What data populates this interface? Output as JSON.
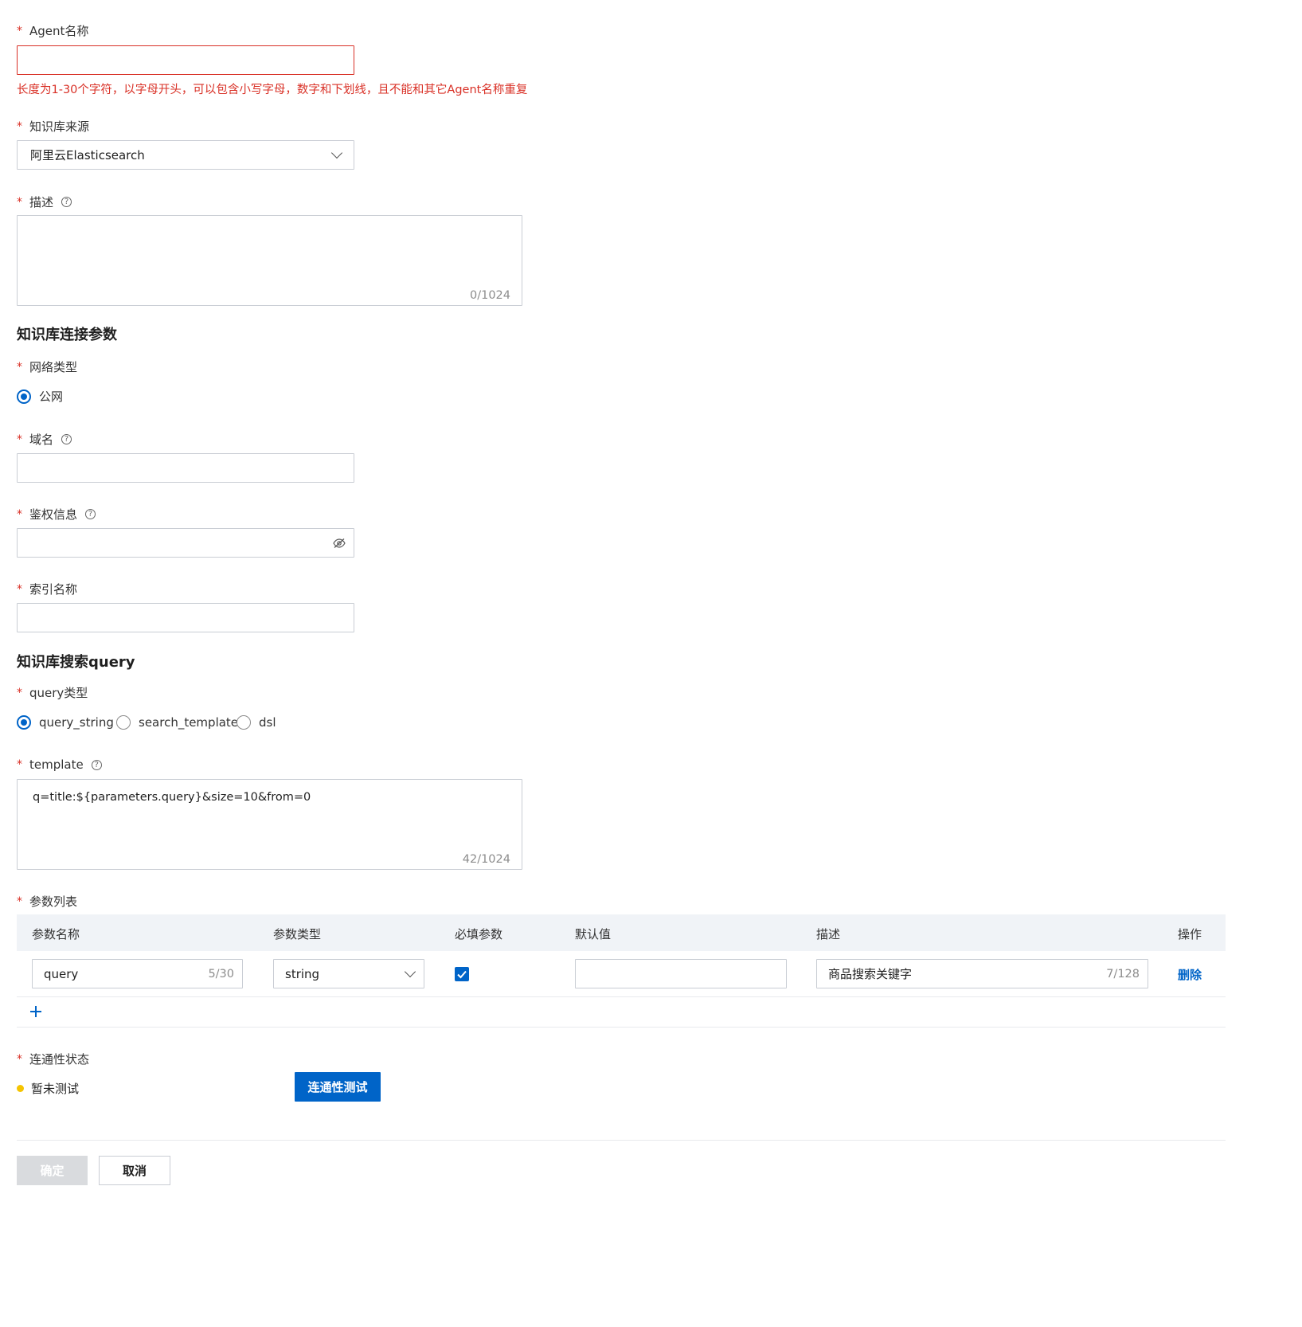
{
  "agent_name": {
    "label": "Agent名称",
    "value": "",
    "error": "长度为1-30个字符，以字母开头，可以包含小写字母，数字和下划线，且不能和其它Agent名称重复"
  },
  "kb_source": {
    "label": "知识库来源",
    "value": "阿里云Elasticsearch"
  },
  "description": {
    "label": "描述",
    "value": "",
    "counter": "0/1024"
  },
  "section_conn": {
    "title": "知识库连接参数"
  },
  "network_type": {
    "label": "网络类型",
    "options": [
      "公网"
    ],
    "selected": "公网"
  },
  "domain": {
    "label": "域名",
    "value": ""
  },
  "auth": {
    "label": "鉴权信息",
    "value": ""
  },
  "index_name": {
    "label": "索引名称",
    "value": ""
  },
  "section_query": {
    "title": "知识库搜索query"
  },
  "query_type": {
    "label": "query类型",
    "options": [
      "query_string",
      "search_template",
      "dsl"
    ],
    "selected": "query_string"
  },
  "template": {
    "label": "template",
    "value": "q=title:${parameters.query}&size=10&from=0",
    "counter": "42/1024"
  },
  "params": {
    "label": "参数列表",
    "columns": [
      "参数名称",
      "参数类型",
      "必填参数",
      "默认值",
      "描述",
      "操作"
    ],
    "rows": [
      {
        "name": "query",
        "name_counter": "5/30",
        "type": "string",
        "required": true,
        "default": "",
        "desc": "商品搜索关键字",
        "desc_counter": "7/128",
        "action": "删除"
      }
    ],
    "add_icon": "plus-icon"
  },
  "connectivity": {
    "label": "连通性状态",
    "status": "暂未测试",
    "status_color": "#f5c400",
    "test_button": "连通性测试"
  },
  "footer": {
    "confirm": "确定",
    "cancel": "取消"
  },
  "colors": {
    "primary": "#0064c8",
    "error": "#d93026"
  }
}
